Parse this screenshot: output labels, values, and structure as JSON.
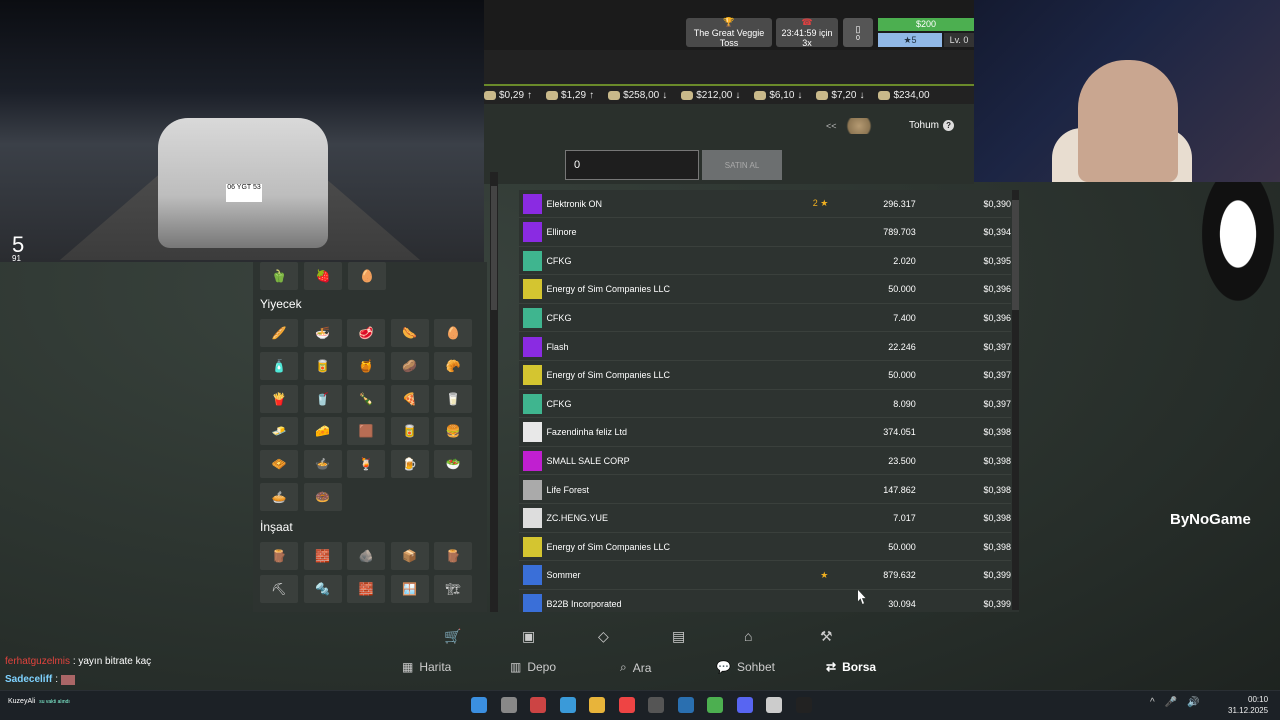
{
  "header": {
    "event_label": "The Great Veggie Toss",
    "timer_label": "23:41:59 için 3x",
    "counter": "0",
    "money": "$200",
    "xp": "5",
    "level": "Lv. 0"
  },
  "ticker": [
    {
      "price": "$0,29",
      "dir": "↑"
    },
    {
      "price": "$1,29",
      "dir": "↑"
    },
    {
      "price": "$258,00",
      "dir": "↓"
    },
    {
      "price": "$212,00",
      "dir": "↓"
    },
    {
      "price": "$6,10",
      "dir": "↓"
    },
    {
      "price": "$7,20",
      "dir": "↓"
    },
    {
      "price": "$234,00",
      "dir": ""
    }
  ],
  "market": {
    "back": "<<",
    "product": "Tohum",
    "help": "?",
    "quantity": "0",
    "buy_label": "SATIN AL"
  },
  "orders": [
    {
      "seller": "Elektronik ON",
      "rank": "2",
      "star": true,
      "amount": "296.317",
      "price": "$0,390",
      "color": "#8a2be2"
    },
    {
      "seller": "Ellinore",
      "rank": "",
      "star": false,
      "amount": "789.703",
      "price": "$0,394",
      "color": "#8a2be2"
    },
    {
      "seller": "CFKG",
      "rank": "",
      "star": false,
      "amount": "2.020",
      "price": "$0,395",
      "color": "#3fb58f"
    },
    {
      "seller": "Energy of Sim Companies LLC",
      "rank": "",
      "star": false,
      "amount": "50.000",
      "price": "$0,396",
      "color": "#d4c530"
    },
    {
      "seller": "CFKG",
      "rank": "",
      "star": false,
      "amount": "7.400",
      "price": "$0,396",
      "color": "#3fb58f"
    },
    {
      "seller": "Flash",
      "rank": "",
      "star": false,
      "amount": "22.246",
      "price": "$0,397",
      "color": "#8a2be2"
    },
    {
      "seller": "Energy of Sim Companies LLC",
      "rank": "",
      "star": false,
      "amount": "50.000",
      "price": "$0,397",
      "color": "#d4c530"
    },
    {
      "seller": "CFKG",
      "rank": "",
      "star": false,
      "amount": "8.090",
      "price": "$0,397",
      "color": "#3fb58f"
    },
    {
      "seller": "Fazendinha feliz Ltd",
      "rank": "",
      "star": false,
      "amount": "374.051",
      "price": "$0,398",
      "color": "#e8e8e8"
    },
    {
      "seller": "SMALL SALE CORP",
      "rank": "",
      "star": false,
      "amount": "23.500",
      "price": "$0,398",
      "color": "#c01fd0"
    },
    {
      "seller": "Life Forest",
      "rank": "",
      "star": false,
      "amount": "147.862",
      "price": "$0,398",
      "color": "#aaaaaa"
    },
    {
      "seller": "ZC.HENG.YUE",
      "rank": "",
      "star": false,
      "amount": "7.017",
      "price": "$0,398",
      "color": "#dddddd"
    },
    {
      "seller": "Energy of Sim Companies LLC",
      "rank": "",
      "star": false,
      "amount": "50.000",
      "price": "$0,398",
      "color": "#d4c530"
    },
    {
      "seller": "Sommer",
      "rank": "",
      "star": true,
      "amount": "879.632",
      "price": "$0,399",
      "color": "#3a6fd8"
    },
    {
      "seller": "B22B Incorporated",
      "rank": "",
      "star": false,
      "amount": "30.094",
      "price": "$0,399",
      "color": "#3a6fd8"
    }
  ],
  "categories": {
    "food": "Yiyecek",
    "construction": "İnşaat"
  },
  "bottom_nav": {
    "map": "Harita",
    "depot": "Depo",
    "search": "Ara",
    "chat": "Sohbet",
    "exchange": "Borsa"
  },
  "stream": {
    "speed": "5",
    "speed_sub": "91",
    "plate": "06 YGT 53",
    "brand": "ByNoGame",
    "chat_user1": "ferhatguzelmis",
    "chat_msg1": ": yayın bitrate kaç",
    "chat_user2": "Sadeceliff",
    "chat_msg2": ":",
    "streamer_name": "KuzeyAli",
    "streamer_status": "su vakti alındı"
  },
  "taskbar": {
    "time": "00:10",
    "date": "31.12.2025"
  }
}
